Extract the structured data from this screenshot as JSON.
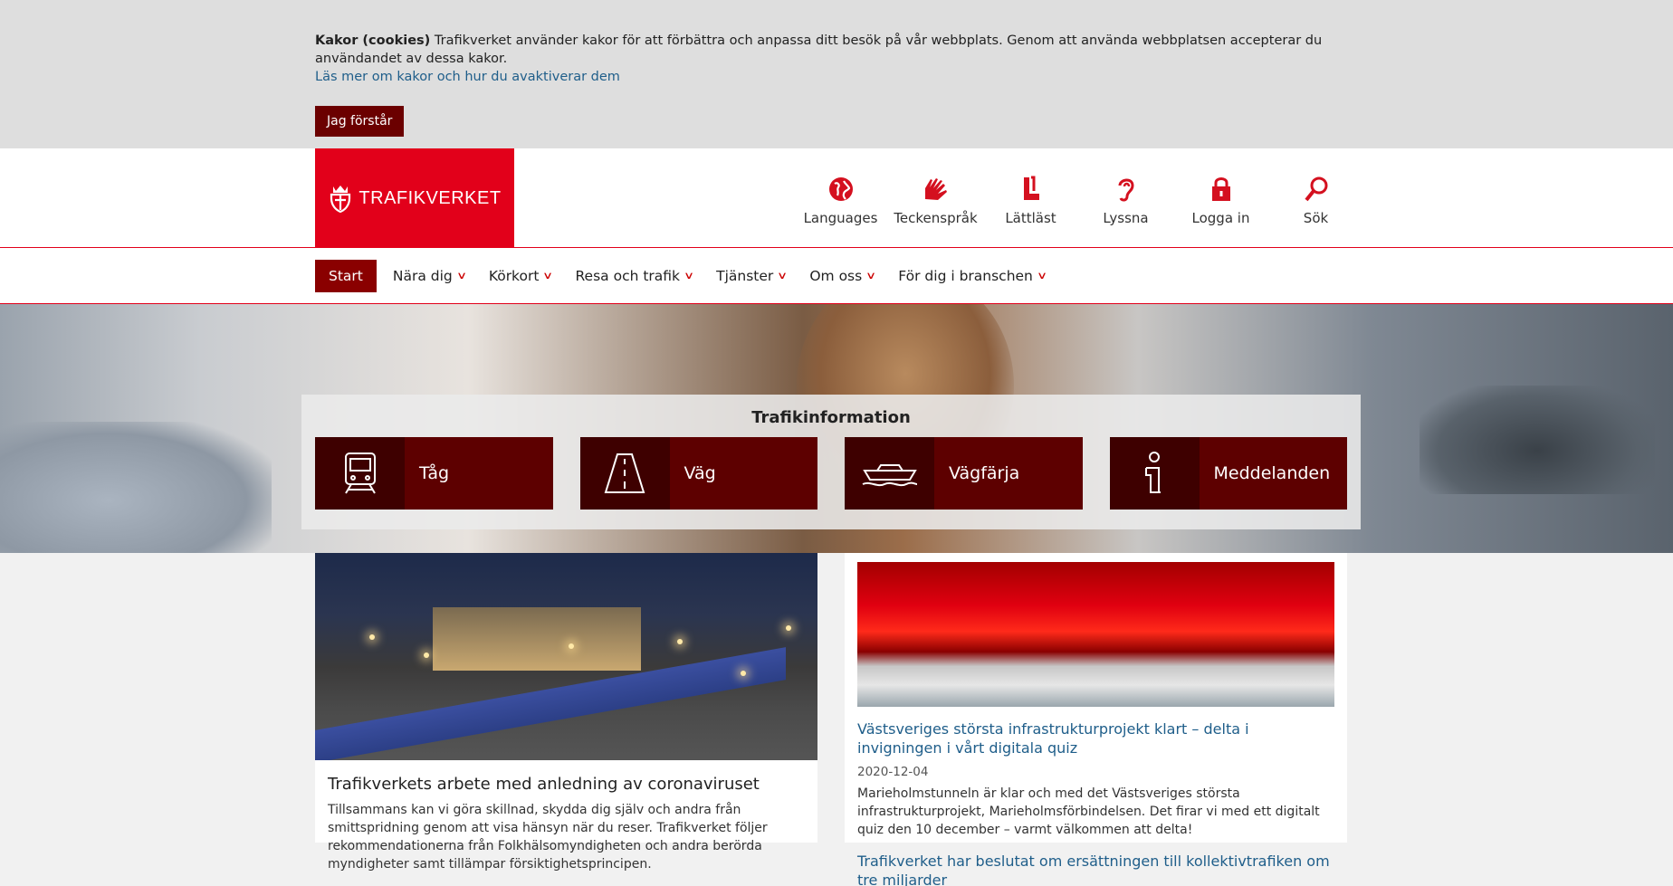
{
  "cookie": {
    "title": "Kakor (cookies)",
    "text": "Trafikverket använder kakor för att förbättra och anpassa ditt besök på vår webbplats. Genom att använda webbplatsen accepterar du användandet av dessa kakor.",
    "link": "Läs mer om kakor och hur du avaktiverar dem",
    "button": "Jag förstår"
  },
  "header": {
    "logo_text": "TRAFIKVERKET",
    "tools": [
      {
        "label": "Languages",
        "icon": "globe-icon"
      },
      {
        "label": "Teckenspråk",
        "icon": "sign-language-icon"
      },
      {
        "label": "Lättläst",
        "icon": "easy-read-icon"
      },
      {
        "label": "Lyssna",
        "icon": "ear-icon"
      },
      {
        "label": "Logga in",
        "icon": "lock-icon"
      },
      {
        "label": "Sök",
        "icon": "search-icon"
      }
    ]
  },
  "nav": {
    "items": [
      {
        "label": "Start",
        "active": true
      },
      {
        "label": "Nära dig"
      },
      {
        "label": "Körkort"
      },
      {
        "label": "Resa och trafik"
      },
      {
        "label": "Tjänster"
      },
      {
        "label": "Om oss"
      },
      {
        "label": "För dig i branschen"
      }
    ]
  },
  "traffic": {
    "title": "Trafikinformation",
    "tiles": [
      {
        "label": "Tåg",
        "icon": "train-icon"
      },
      {
        "label": "Väg",
        "icon": "road-icon"
      },
      {
        "label": "Vägfärja",
        "icon": "ferry-icon"
      },
      {
        "label": "Meddelanden",
        "icon": "info-icon"
      }
    ]
  },
  "main": {
    "feature": {
      "title": "Trafikverkets arbete med anledning av coronaviruset",
      "text": "Tillsammans kan vi göra skillnad, skydda dig själv och andra från smittspridning genom att visa hänsyn när du reser. Trafikverket följer rekommendationerna från Folkhälsomyndigheten och andra berörda myndigheter samt tillämpar försiktighetsprincipen."
    },
    "news": [
      {
        "title": "Västsveriges största infrastrukturprojekt klart – delta i invigningen i vårt digitala quiz",
        "date": "2020-12-04",
        "text": "Marieholmstunneln är klar och med det Västsveriges största infrastrukturprojekt, Marieholmsförbindelsen. Det firar vi med ett digitalt quiz den 10 december – varmt välkommen att delta!"
      },
      {
        "title": "Trafikverket har beslutat om ersättningen till kollektivtrafiken om tre miljarder"
      }
    ]
  },
  "colors": {
    "brand_red": "#e2001a",
    "dark_red": "#5d0000",
    "link": "#1f5e8a"
  }
}
